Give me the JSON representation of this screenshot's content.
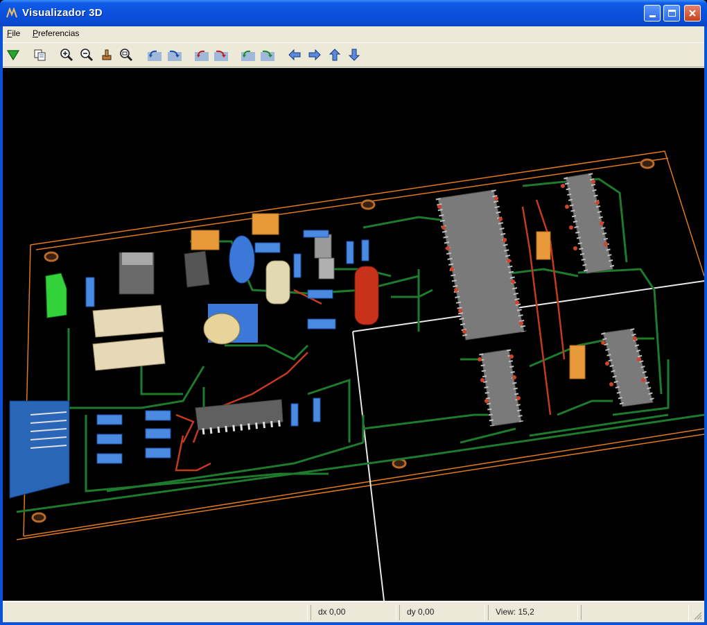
{
  "window": {
    "title": "Visualizador 3D"
  },
  "menu": {
    "file": "File",
    "preferences": "Preferencias"
  },
  "toolbar": [
    {
      "name": "load-down-arrow-icon"
    },
    {
      "name": "copy-icon"
    },
    {
      "name": "zoom-in-icon"
    },
    {
      "name": "zoom-out-icon"
    },
    {
      "name": "pan-hand-icon"
    },
    {
      "name": "zoom-fit-icon"
    },
    {
      "name": "rotate-x-left-icon"
    },
    {
      "name": "rotate-x-right-icon"
    },
    {
      "name": "rotate-y-left-icon"
    },
    {
      "name": "rotate-y-right-icon"
    },
    {
      "name": "rotate-z-left-icon"
    },
    {
      "name": "rotate-z-right-icon"
    },
    {
      "name": "arrow-left-icon"
    },
    {
      "name": "arrow-right-icon"
    },
    {
      "name": "arrow-up-icon"
    },
    {
      "name": "arrow-down-icon"
    }
  ],
  "status": {
    "dx": "dx 0,00",
    "dy": "dy 0,00",
    "view": "View: 15,2"
  },
  "colors": {
    "board_outline": "#e07a1a",
    "trace": "#1e7a2c",
    "pad": "#d0442a",
    "ic_body": "#7a7a7a",
    "background": "#000000"
  }
}
